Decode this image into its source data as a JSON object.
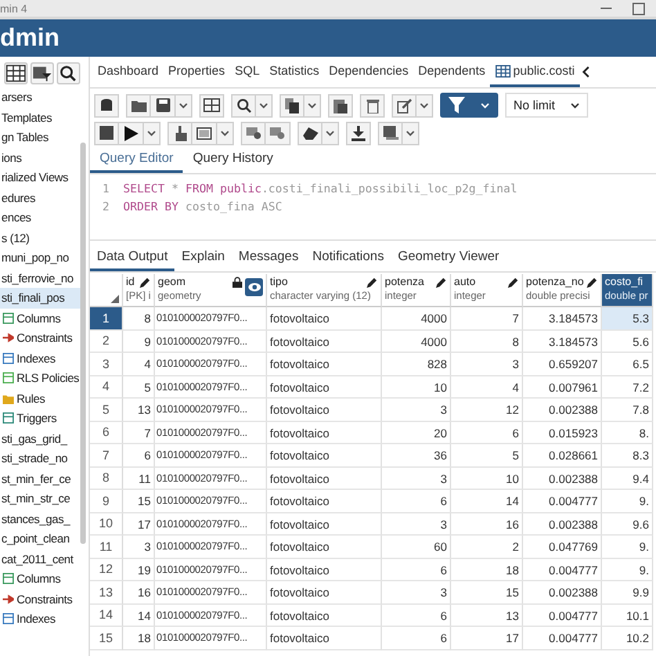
{
  "window": {
    "title": "min 4"
  },
  "app": {
    "title": "dmin"
  },
  "sidebar": {
    "items": [
      {
        "label": "arsers",
        "selected": false
      },
      {
        "label": "Templates",
        "selected": false
      },
      {
        "label": "gn Tables",
        "selected": false
      },
      {
        "label": "ions",
        "selected": false
      },
      {
        "label": "rialized Views",
        "selected": false
      },
      {
        "label": "edures",
        "selected": false
      },
      {
        "label": "ences",
        "selected": false
      },
      {
        "label": "s (12)",
        "selected": false
      },
      {
        "label": "muni_pop_no",
        "selected": false
      },
      {
        "label": "sti_ferrovie_no",
        "selected": false
      },
      {
        "label": "sti_finali_pos",
        "selected": true,
        "children": [
          {
            "label": "Columns",
            "kind": "columns",
            "selected": false
          },
          {
            "label": "Constraints",
            "kind": "constraints",
            "selected": false
          },
          {
            "label": "Indexes",
            "kind": "indexes",
            "selected": false
          },
          {
            "label": "RLS Policies",
            "kind": "policies",
            "selected": false
          },
          {
            "label": "Rules",
            "kind": "rules",
            "selected": false
          },
          {
            "label": "Triggers",
            "kind": "triggers",
            "selected": false
          }
        ]
      },
      {
        "label": "sti_gas_grid_",
        "selected": false
      },
      {
        "label": "sti_strade_no",
        "selected": false
      },
      {
        "label": "st_min_fer_ce",
        "selected": false
      },
      {
        "label": "st_min_str_ce",
        "selected": false
      },
      {
        "label": "stances_gas_",
        "selected": false
      },
      {
        "label": "c_point_clean",
        "selected": false
      },
      {
        "label": "cat_2011_cent",
        "selected": false,
        "children": [
          {
            "label": "Columns",
            "kind": "columns",
            "selected": false
          },
          {
            "label": "Constraints",
            "kind": "constraints",
            "selected": false
          },
          {
            "label": "Indexes",
            "kind": "indexes",
            "selected": false
          }
        ]
      }
    ]
  },
  "tabs": [
    {
      "label": "Dashboard",
      "selected": false
    },
    {
      "label": "Properties",
      "selected": false
    },
    {
      "label": "SQL",
      "selected": false
    },
    {
      "label": "Statistics",
      "selected": false
    },
    {
      "label": "Dependencies",
      "selected": false
    },
    {
      "label": "Dependents",
      "selected": false
    },
    {
      "label": "public.costi",
      "selected": true,
      "kind": "table"
    }
  ],
  "toolbar": {
    "limit": "No limit"
  },
  "editor_tabs": [
    {
      "label": "Query Editor",
      "selected": true
    },
    {
      "label": "Query History",
      "selected": false
    }
  ],
  "code_lines": [
    {
      "number": "1",
      "segments": [
        {
          "text": "SELECT",
          "kind": "keyword"
        },
        {
          "text": " * ",
          "kind": "plain"
        },
        {
          "text": "FROM",
          "kind": "keyword"
        },
        {
          "text": " public",
          "kind": "keyword"
        },
        {
          "text": ".costi_finali_possibili_loc_p2g_final",
          "kind": "plain"
        }
      ]
    },
    {
      "number": "2",
      "segments": [
        {
          "text": "ORDER BY",
          "kind": "keyword"
        },
        {
          "text": " costo_fina ASC",
          "kind": "plain"
        }
      ]
    }
  ],
  "result_tabs": [
    {
      "label": "Data Output",
      "selected": true
    },
    {
      "label": "Explain",
      "selected": false
    },
    {
      "label": "Messages",
      "selected": false
    },
    {
      "label": "Notifications",
      "selected": false
    },
    {
      "label": "Geometry Viewer",
      "selected": false
    }
  ],
  "table": {
    "columns": [
      {
        "name": "id",
        "type": "[PK] i",
        "kind": "editable",
        "selected": false
      },
      {
        "name": "geom",
        "type": "geometry",
        "kind": "geometry",
        "selected": false
      },
      {
        "name": "tipo",
        "type": "character varying (12)",
        "kind": "editable",
        "selected": false
      },
      {
        "name": "potenza",
        "type": "integer",
        "kind": "editable",
        "selected": false
      },
      {
        "name": "auto",
        "type": "integer",
        "kind": "editable",
        "selected": false
      },
      {
        "name": "potenza_no",
        "type": "double precisi",
        "kind": "editable",
        "selected": false
      },
      {
        "name": "costo_fi",
        "type": "double pr",
        "kind": "editable",
        "selected": true
      }
    ],
    "rows": [
      {
        "n": "1",
        "selected": true,
        "cells": [
          "8",
          "0101000020797F0...",
          "fotovoltaico",
          "4000",
          "7",
          "3.184573",
          "5.3"
        ]
      },
      {
        "n": "2",
        "selected": false,
        "cells": [
          "9",
          "0101000020797F0...",
          "fotovoltaico",
          "4000",
          "8",
          "3.184573",
          "5.6"
        ]
      },
      {
        "n": "3",
        "selected": false,
        "cells": [
          "4",
          "0101000020797F0...",
          "fotovoltaico",
          "828",
          "3",
          "0.659207",
          "6.5"
        ]
      },
      {
        "n": "4",
        "selected": false,
        "cells": [
          "5",
          "0101000020797F0...",
          "fotovoltaico",
          "10",
          "4",
          "0.007961",
          "7.2"
        ]
      },
      {
        "n": "5",
        "selected": false,
        "cells": [
          "13",
          "0101000020797F0...",
          "fotovoltaico",
          "3",
          "12",
          "0.002388",
          "7.8"
        ]
      },
      {
        "n": "6",
        "selected": false,
        "cells": [
          "7",
          "0101000020797F0...",
          "fotovoltaico",
          "20",
          "6",
          "0.015923",
          "8."
        ]
      },
      {
        "n": "7",
        "selected": false,
        "cells": [
          "6",
          "0101000020797F0...",
          "fotovoltaico",
          "36",
          "5",
          "0.028661",
          "8.3"
        ]
      },
      {
        "n": "8",
        "selected": false,
        "cells": [
          "11",
          "0101000020797F0...",
          "fotovoltaico",
          "3",
          "10",
          "0.002388",
          "9.4"
        ]
      },
      {
        "n": "9",
        "selected": false,
        "cells": [
          "15",
          "0101000020797F0...",
          "fotovoltaico",
          "6",
          "14",
          "0.004777",
          "9."
        ]
      },
      {
        "n": "10",
        "selected": false,
        "cells": [
          "17",
          "0101000020797F0...",
          "fotovoltaico",
          "3",
          "16",
          "0.002388",
          "9.6"
        ]
      },
      {
        "n": "11",
        "selected": false,
        "cells": [
          "3",
          "0101000020797F0...",
          "fotovoltaico",
          "60",
          "2",
          "0.047769",
          "9."
        ]
      },
      {
        "n": "12",
        "selected": false,
        "cells": [
          "19",
          "0101000020797F0...",
          "fotovoltaico",
          "6",
          "18",
          "0.004777",
          "9."
        ]
      },
      {
        "n": "13",
        "selected": false,
        "cells": [
          "16",
          "0101000020797F0...",
          "fotovoltaico",
          "3",
          "15",
          "0.002388",
          "9.9"
        ]
      },
      {
        "n": "14",
        "selected": false,
        "cells": [
          "14",
          "0101000020797F0...",
          "fotovoltaico",
          "6",
          "13",
          "0.004777",
          "10.1"
        ]
      },
      {
        "n": "15",
        "selected": false,
        "cells": [
          "18",
          "0101000020797F0...",
          "fotovoltaico",
          "6",
          "17",
          "0.004777",
          "10.2"
        ]
      }
    ]
  }
}
